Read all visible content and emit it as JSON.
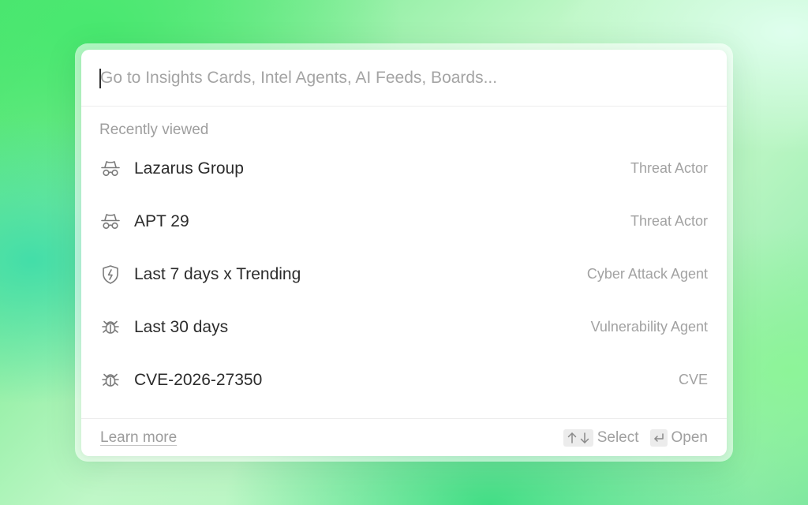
{
  "search": {
    "placeholder": "Go to Insights Cards, Intel Agents, AI Feeds, Boards..."
  },
  "recent": {
    "label": "Recently viewed",
    "items": [
      {
        "name": "Lazarus Group",
        "type": "Threat Actor",
        "icon": "spy-icon"
      },
      {
        "name": "APT 29",
        "type": "Threat Actor",
        "icon": "spy-icon"
      },
      {
        "name": "Last 7 days x Trending",
        "type": "Cyber Attack Agent",
        "icon": "shield-bolt-icon"
      },
      {
        "name": "Last 30 days",
        "type": "Vulnerability Agent",
        "icon": "bug-icon"
      },
      {
        "name": "CVE-2026-27350",
        "type": "CVE",
        "icon": "bug-icon"
      }
    ]
  },
  "footer": {
    "learn_more": "Learn more",
    "select_label": "Select",
    "open_label": "Open"
  }
}
